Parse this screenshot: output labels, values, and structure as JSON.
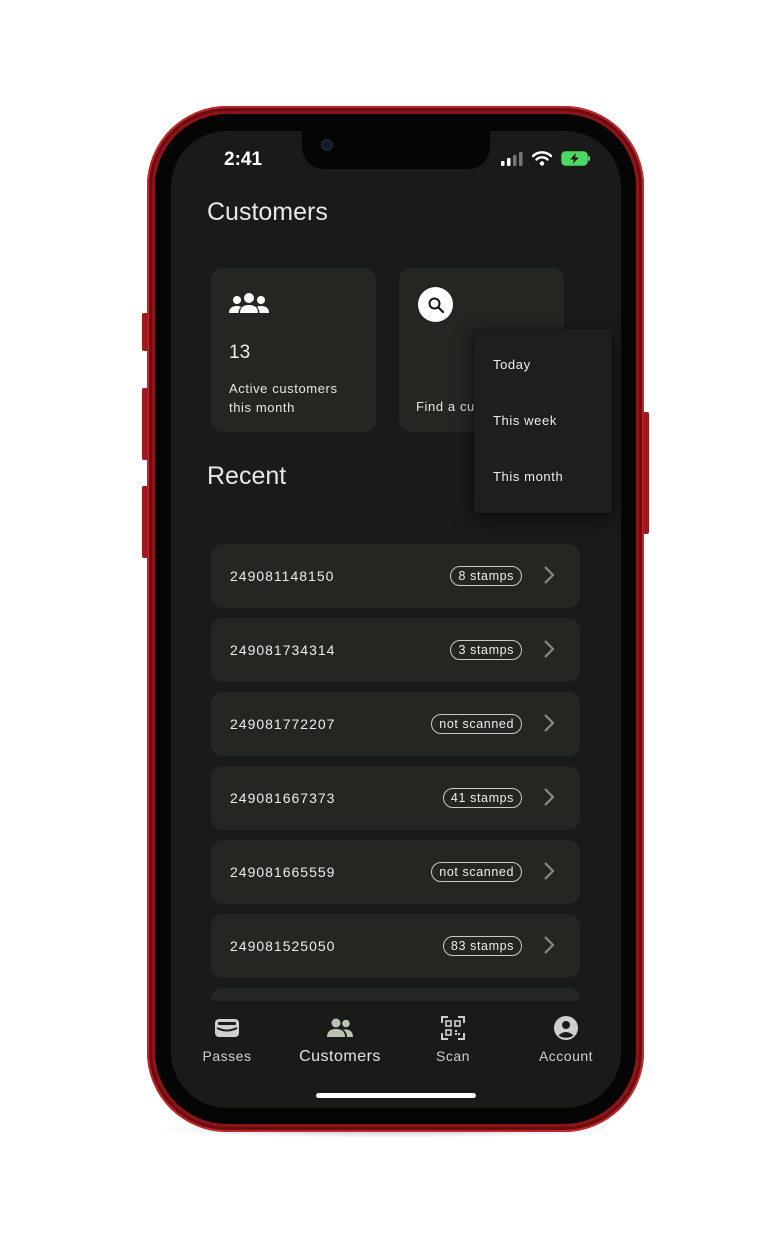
{
  "status_bar": {
    "time": "2:41"
  },
  "header": {
    "title": "Customers"
  },
  "stats": {
    "active_value": "13",
    "active_label": "Active customers this month",
    "find_label": "Find a cu"
  },
  "recent": {
    "title": "Recent",
    "items": [
      {
        "id": "249081148150",
        "badge": "8 stamps"
      },
      {
        "id": "249081734314",
        "badge": "3 stamps"
      },
      {
        "id": "249081772207",
        "badge": "not scanned"
      },
      {
        "id": "249081667373",
        "badge": "41 stamps"
      },
      {
        "id": "249081665559",
        "badge": "not scanned"
      },
      {
        "id": "249081525050",
        "badge": "83 stamps"
      }
    ]
  },
  "dropdown": {
    "options": [
      "Today",
      "This week",
      "This month"
    ]
  },
  "nav": {
    "items": [
      {
        "label": "Passes",
        "icon": "wallet-icon"
      },
      {
        "label": "Customers",
        "icon": "people-icon"
      },
      {
        "label": "Scan",
        "icon": "qr-code-icon"
      },
      {
        "label": "Account",
        "icon": "account-circle-icon"
      }
    ],
    "active": "Customers"
  },
  "colors": {
    "phone_frame": "#8f1418",
    "screen_bg": "#1a1b19",
    "card_bg": "#242622",
    "active_nav_icon": "#b8c4b2"
  }
}
